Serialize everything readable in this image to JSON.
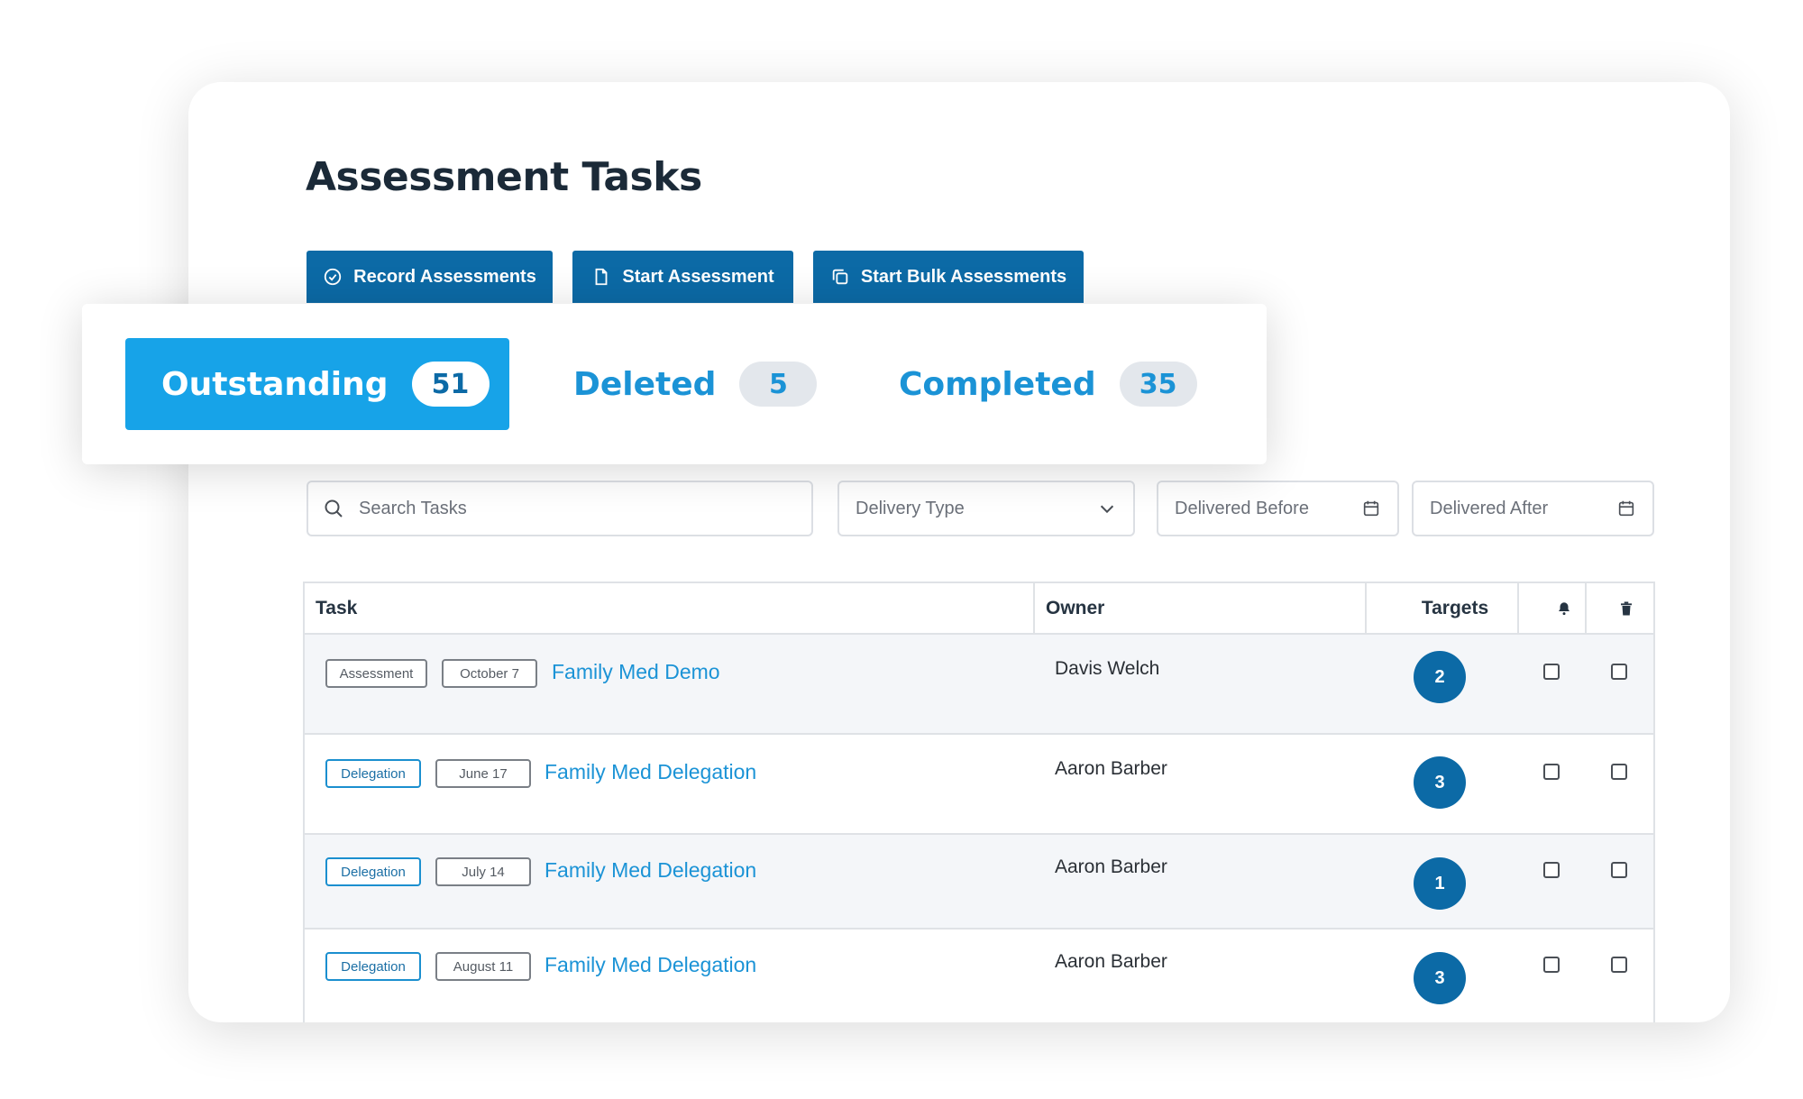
{
  "page": {
    "title": "Assessment Tasks"
  },
  "actions": [
    {
      "label": "Record Assessments",
      "icon": "check-circle-icon"
    },
    {
      "label": "Start Assessment",
      "icon": "document-icon"
    },
    {
      "label": "Start Bulk Assessments",
      "icon": "copy-documents-icon"
    }
  ],
  "tabs": [
    {
      "label": "Outstanding",
      "count": "51",
      "active": true
    },
    {
      "label": "Deleted",
      "count": "5",
      "active": false
    },
    {
      "label": "Completed",
      "count": "35",
      "active": false
    }
  ],
  "filters": {
    "search_placeholder": "Search Tasks",
    "delivery_type": "Delivery Type",
    "delivered_before": "Delivered Before",
    "delivered_after": "Delivered After"
  },
  "table": {
    "columns": {
      "task": "Task",
      "owner": "Owner",
      "targets": "Targets",
      "notify_icon": "bell-icon",
      "delete_icon": "trash-icon"
    },
    "rows": [
      {
        "type": "Assessment",
        "type_style": "gray",
        "date": "October 7",
        "task": "Family Med Demo",
        "owner": "Davis Welch",
        "targets": "2"
      },
      {
        "type": "Delegation",
        "type_style": "blue",
        "date": "June 17",
        "task": "Family Med Delegation",
        "owner": "Aaron Barber",
        "targets": "3"
      },
      {
        "type": "Delegation",
        "type_style": "blue",
        "date": "July 14",
        "task": "Family Med Delegation",
        "owner": "Aaron Barber",
        "targets": "1"
      },
      {
        "type": "Delegation",
        "type_style": "blue",
        "date": "August 11",
        "task": "Family Med Delegation",
        "owner": "Aaron Barber",
        "targets": "3"
      }
    ]
  },
  "colors": {
    "primary": "#0c6aa6",
    "accent": "#17a3e8",
    "link": "#1b93d6"
  }
}
